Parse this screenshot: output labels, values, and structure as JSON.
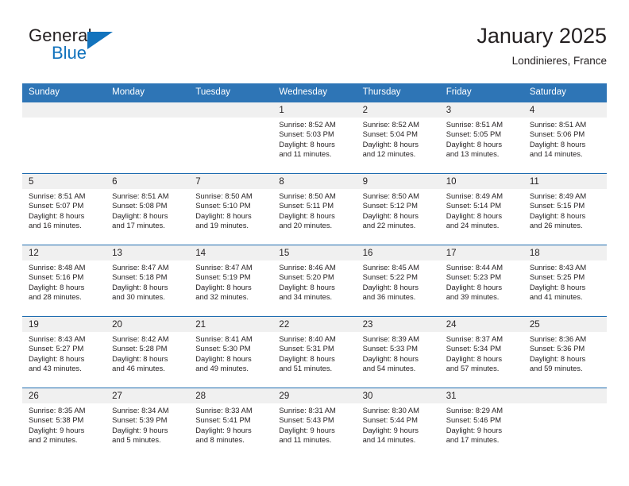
{
  "logo": {
    "primary_text": "General",
    "secondary_text": "Blue",
    "accent_color": "#1273bd",
    "triangle_icon": "triangle-icon"
  },
  "header": {
    "title": "January 2025",
    "subtitle": "Londinieres, France"
  },
  "theme": {
    "header_bar_color": "#2e75b6",
    "row_divider_color": "#1f6cb0",
    "daynum_band_color": "#f0f0f0",
    "text_color": "#231f20"
  },
  "weekdays": [
    "Sunday",
    "Monday",
    "Tuesday",
    "Wednesday",
    "Thursday",
    "Friday",
    "Saturday"
  ],
  "weeks": [
    [
      {
        "day": "",
        "sunrise": "",
        "sunset": "",
        "daylight1": "",
        "daylight2": "",
        "empty": true
      },
      {
        "day": "",
        "sunrise": "",
        "sunset": "",
        "daylight1": "",
        "daylight2": "",
        "empty": true
      },
      {
        "day": "",
        "sunrise": "",
        "sunset": "",
        "daylight1": "",
        "daylight2": "",
        "empty": true
      },
      {
        "day": "1",
        "sunrise": "Sunrise: 8:52 AM",
        "sunset": "Sunset: 5:03 PM",
        "daylight1": "Daylight: 8 hours",
        "daylight2": "and 11 minutes.",
        "empty": false
      },
      {
        "day": "2",
        "sunrise": "Sunrise: 8:52 AM",
        "sunset": "Sunset: 5:04 PM",
        "daylight1": "Daylight: 8 hours",
        "daylight2": "and 12 minutes.",
        "empty": false
      },
      {
        "day": "3",
        "sunrise": "Sunrise: 8:51 AM",
        "sunset": "Sunset: 5:05 PM",
        "daylight1": "Daylight: 8 hours",
        "daylight2": "and 13 minutes.",
        "empty": false
      },
      {
        "day": "4",
        "sunrise": "Sunrise: 8:51 AM",
        "sunset": "Sunset: 5:06 PM",
        "daylight1": "Daylight: 8 hours",
        "daylight2": "and 14 minutes.",
        "empty": false
      }
    ],
    [
      {
        "day": "5",
        "sunrise": "Sunrise: 8:51 AM",
        "sunset": "Sunset: 5:07 PM",
        "daylight1": "Daylight: 8 hours",
        "daylight2": "and 16 minutes.",
        "empty": false
      },
      {
        "day": "6",
        "sunrise": "Sunrise: 8:51 AM",
        "sunset": "Sunset: 5:08 PM",
        "daylight1": "Daylight: 8 hours",
        "daylight2": "and 17 minutes.",
        "empty": false
      },
      {
        "day": "7",
        "sunrise": "Sunrise: 8:50 AM",
        "sunset": "Sunset: 5:10 PM",
        "daylight1": "Daylight: 8 hours",
        "daylight2": "and 19 minutes.",
        "empty": false
      },
      {
        "day": "8",
        "sunrise": "Sunrise: 8:50 AM",
        "sunset": "Sunset: 5:11 PM",
        "daylight1": "Daylight: 8 hours",
        "daylight2": "and 20 minutes.",
        "empty": false
      },
      {
        "day": "9",
        "sunrise": "Sunrise: 8:50 AM",
        "sunset": "Sunset: 5:12 PM",
        "daylight1": "Daylight: 8 hours",
        "daylight2": "and 22 minutes.",
        "empty": false
      },
      {
        "day": "10",
        "sunrise": "Sunrise: 8:49 AM",
        "sunset": "Sunset: 5:14 PM",
        "daylight1": "Daylight: 8 hours",
        "daylight2": "and 24 minutes.",
        "empty": false
      },
      {
        "day": "11",
        "sunrise": "Sunrise: 8:49 AM",
        "sunset": "Sunset: 5:15 PM",
        "daylight1": "Daylight: 8 hours",
        "daylight2": "and 26 minutes.",
        "empty": false
      }
    ],
    [
      {
        "day": "12",
        "sunrise": "Sunrise: 8:48 AM",
        "sunset": "Sunset: 5:16 PM",
        "daylight1": "Daylight: 8 hours",
        "daylight2": "and 28 minutes.",
        "empty": false
      },
      {
        "day": "13",
        "sunrise": "Sunrise: 8:47 AM",
        "sunset": "Sunset: 5:18 PM",
        "daylight1": "Daylight: 8 hours",
        "daylight2": "and 30 minutes.",
        "empty": false
      },
      {
        "day": "14",
        "sunrise": "Sunrise: 8:47 AM",
        "sunset": "Sunset: 5:19 PM",
        "daylight1": "Daylight: 8 hours",
        "daylight2": "and 32 minutes.",
        "empty": false
      },
      {
        "day": "15",
        "sunrise": "Sunrise: 8:46 AM",
        "sunset": "Sunset: 5:20 PM",
        "daylight1": "Daylight: 8 hours",
        "daylight2": "and 34 minutes.",
        "empty": false
      },
      {
        "day": "16",
        "sunrise": "Sunrise: 8:45 AM",
        "sunset": "Sunset: 5:22 PM",
        "daylight1": "Daylight: 8 hours",
        "daylight2": "and 36 minutes.",
        "empty": false
      },
      {
        "day": "17",
        "sunrise": "Sunrise: 8:44 AM",
        "sunset": "Sunset: 5:23 PM",
        "daylight1": "Daylight: 8 hours",
        "daylight2": "and 39 minutes.",
        "empty": false
      },
      {
        "day": "18",
        "sunrise": "Sunrise: 8:43 AM",
        "sunset": "Sunset: 5:25 PM",
        "daylight1": "Daylight: 8 hours",
        "daylight2": "and 41 minutes.",
        "empty": false
      }
    ],
    [
      {
        "day": "19",
        "sunrise": "Sunrise: 8:43 AM",
        "sunset": "Sunset: 5:27 PM",
        "daylight1": "Daylight: 8 hours",
        "daylight2": "and 43 minutes.",
        "empty": false
      },
      {
        "day": "20",
        "sunrise": "Sunrise: 8:42 AM",
        "sunset": "Sunset: 5:28 PM",
        "daylight1": "Daylight: 8 hours",
        "daylight2": "and 46 minutes.",
        "empty": false
      },
      {
        "day": "21",
        "sunrise": "Sunrise: 8:41 AM",
        "sunset": "Sunset: 5:30 PM",
        "daylight1": "Daylight: 8 hours",
        "daylight2": "and 49 minutes.",
        "empty": false
      },
      {
        "day": "22",
        "sunrise": "Sunrise: 8:40 AM",
        "sunset": "Sunset: 5:31 PM",
        "daylight1": "Daylight: 8 hours",
        "daylight2": "and 51 minutes.",
        "empty": false
      },
      {
        "day": "23",
        "sunrise": "Sunrise: 8:39 AM",
        "sunset": "Sunset: 5:33 PM",
        "daylight1": "Daylight: 8 hours",
        "daylight2": "and 54 minutes.",
        "empty": false
      },
      {
        "day": "24",
        "sunrise": "Sunrise: 8:37 AM",
        "sunset": "Sunset: 5:34 PM",
        "daylight1": "Daylight: 8 hours",
        "daylight2": "and 57 minutes.",
        "empty": false
      },
      {
        "day": "25",
        "sunrise": "Sunrise: 8:36 AM",
        "sunset": "Sunset: 5:36 PM",
        "daylight1": "Daylight: 8 hours",
        "daylight2": "and 59 minutes.",
        "empty": false
      }
    ],
    [
      {
        "day": "26",
        "sunrise": "Sunrise: 8:35 AM",
        "sunset": "Sunset: 5:38 PM",
        "daylight1": "Daylight: 9 hours",
        "daylight2": "and 2 minutes.",
        "empty": false
      },
      {
        "day": "27",
        "sunrise": "Sunrise: 8:34 AM",
        "sunset": "Sunset: 5:39 PM",
        "daylight1": "Daylight: 9 hours",
        "daylight2": "and 5 minutes.",
        "empty": false
      },
      {
        "day": "28",
        "sunrise": "Sunrise: 8:33 AM",
        "sunset": "Sunset: 5:41 PM",
        "daylight1": "Daylight: 9 hours",
        "daylight2": "and 8 minutes.",
        "empty": false
      },
      {
        "day": "29",
        "sunrise": "Sunrise: 8:31 AM",
        "sunset": "Sunset: 5:43 PM",
        "daylight1": "Daylight: 9 hours",
        "daylight2": "and 11 minutes.",
        "empty": false
      },
      {
        "day": "30",
        "sunrise": "Sunrise: 8:30 AM",
        "sunset": "Sunset: 5:44 PM",
        "daylight1": "Daylight: 9 hours",
        "daylight2": "and 14 minutes.",
        "empty": false
      },
      {
        "day": "31",
        "sunrise": "Sunrise: 8:29 AM",
        "sunset": "Sunset: 5:46 PM",
        "daylight1": "Daylight: 9 hours",
        "daylight2": "and 17 minutes.",
        "empty": false
      },
      {
        "day": "",
        "sunrise": "",
        "sunset": "",
        "daylight1": "",
        "daylight2": "",
        "empty": true
      }
    ]
  ]
}
